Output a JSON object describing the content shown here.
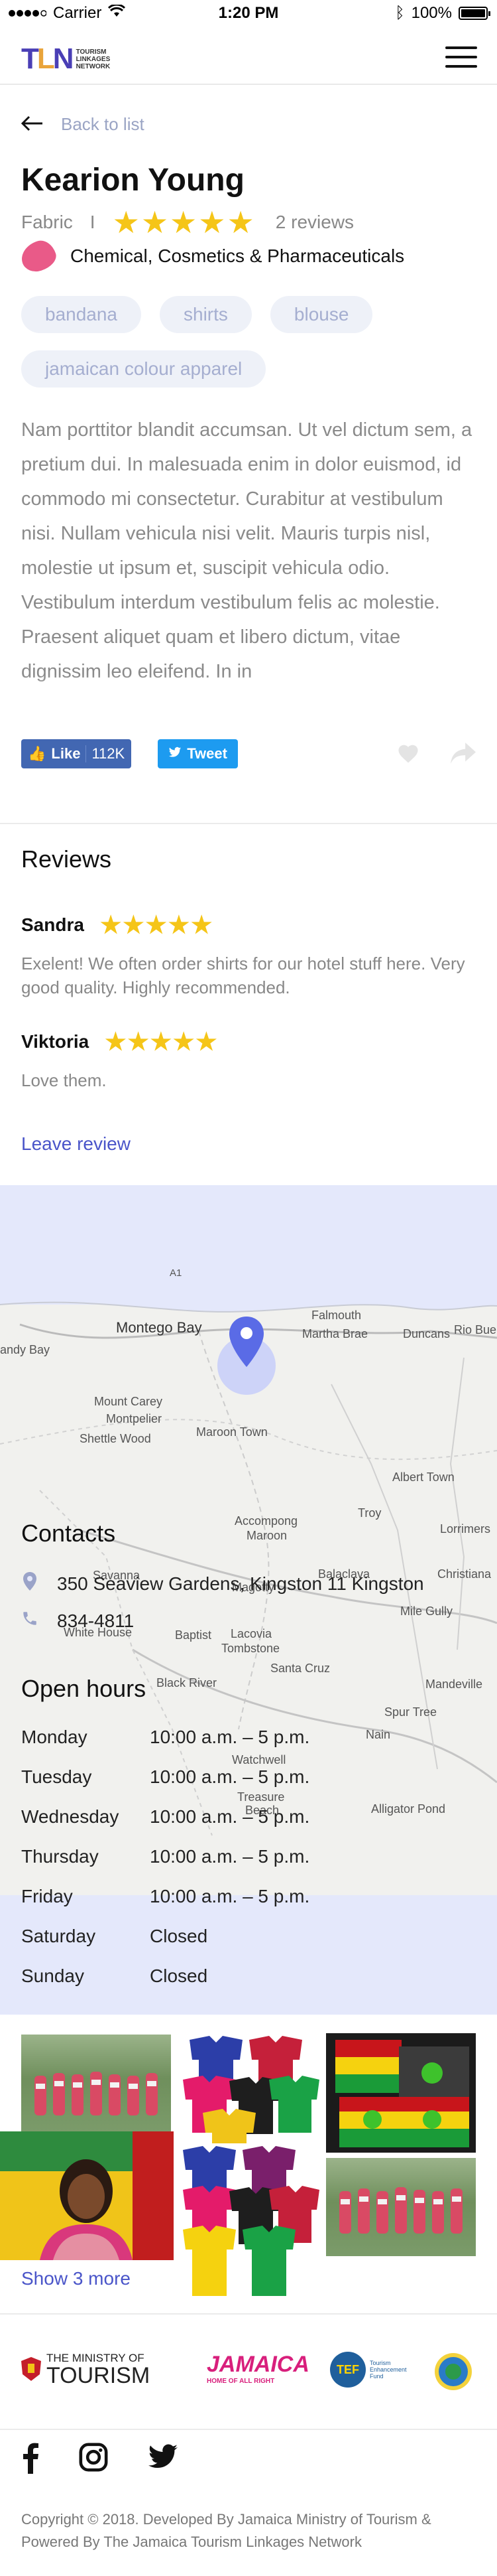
{
  "statusbar": {
    "carrier": "Carrier",
    "time": "1:20 PM",
    "battery": "100%"
  },
  "header": {
    "logo_letters": "TLN",
    "logo_line1": "TOURISM",
    "logo_line2": "LINKAGES",
    "logo_line3": "NETWORK"
  },
  "back": {
    "label": "Back to list"
  },
  "profile": {
    "name": "Kearion Young",
    "category": "Fabric",
    "separator": "I",
    "rating_stars": "★★★★★",
    "reviews_count": "2 reviews",
    "sector": "Chemical, Cosmetics & Pharmaceuticals",
    "tags": [
      "bandana",
      "shirts",
      "blouse",
      "jamaican colour apparel"
    ],
    "description": "Nam porttitor blandit accumsan. Ut vel dictum sem, a pretium dui. In malesuada enim in dolor euismod, id commodo mi consectetur. Curabitur at vestibulum nisi. Nullam vehicula nisi velit. Mauris turpis nisl, molestie ut ipsum et, suscipit vehicula odio. Vestibulum interdum vestibulum felis ac molestie. Praesent aliquet quam et libero dictum, vitae dignissim leo eleifend. In in"
  },
  "share": {
    "fb_label": "Like",
    "fb_count": "112K",
    "tw_label": "Tweet"
  },
  "reviews": {
    "title": "Reviews",
    "items": [
      {
        "author": "Sandra",
        "stars": "★★★★★",
        "text": "Exelent! We often order shirts for our hotel stuff here. Very good quality. Highly recommended."
      },
      {
        "author": "Viktoria",
        "stars": "★★★★★",
        "text": "Love them."
      }
    ],
    "leave_label": "Leave review"
  },
  "map": {
    "labels": [
      "Montego Bay",
      "Falmouth",
      "Martha Brae",
      "Duncans",
      "Rio Bue",
      "andy Bay",
      "Mount Carey",
      "Montpelier",
      "Shettle Wood",
      "Maroon Town",
      "Albert Town",
      "Troy",
      "Lorrimers",
      "Accompong",
      "Maroon",
      "Balaclava",
      "Christiana",
      "Savanna",
      "Magotty",
      "Mile Gully",
      "White House",
      "Baptist",
      "Lacovia",
      "Tombstone",
      "Santa Cruz",
      "Black River",
      "Mandeville",
      "Spur Tree",
      "Nain",
      "Watchwell",
      "Treasure",
      "Beach",
      "Alligator Pond",
      "A1"
    ]
  },
  "contacts": {
    "title": "Contacts",
    "address": "350 Seaview Gardens, Kingston 11 Kingston",
    "phone": "834-4811"
  },
  "hours": {
    "title": "Open hours",
    "rows": [
      {
        "day": "Monday",
        "time": "10:00 a.m. – 5 p.m."
      },
      {
        "day": "Tuesday",
        "time": "10:00 a.m. – 5 p.m."
      },
      {
        "day": "Wednesday",
        "time": "10:00 a.m. – 5 p.m."
      },
      {
        "day": "Thursday",
        "time": "10:00 a.m. – 5 p.m."
      },
      {
        "day": "Friday",
        "time": "10:00 a.m. – 5 p.m."
      },
      {
        "day": "Saturday",
        "time": "Closed"
      },
      {
        "day": "Sunday",
        "time": "Closed"
      }
    ]
  },
  "gallery": {
    "show_more": "Show 3 more"
  },
  "partners": {
    "ministry_line1": "THE MINISTRY OF",
    "ministry_line2": "TOURISM",
    "jamaica": "JAMAICA",
    "jamaica_sub": "HOME OF ALL RIGHT",
    "tef": "TEF",
    "tef_sub1": "Tourism",
    "tef_sub2": "Enhancement",
    "tef_sub3": "Fund"
  },
  "footer": {
    "copyright": "Copyright © 2018. Developed By Jamaica Ministry of Tourism & Powered By The Jamaica Tourism Linkages Network"
  },
  "colors": {
    "accent": "#4a55c9",
    "star": "#f5c518",
    "map_bg": "#e4e8fb",
    "tag_bg": "#eef1f8",
    "pin": "#5a6be6"
  }
}
